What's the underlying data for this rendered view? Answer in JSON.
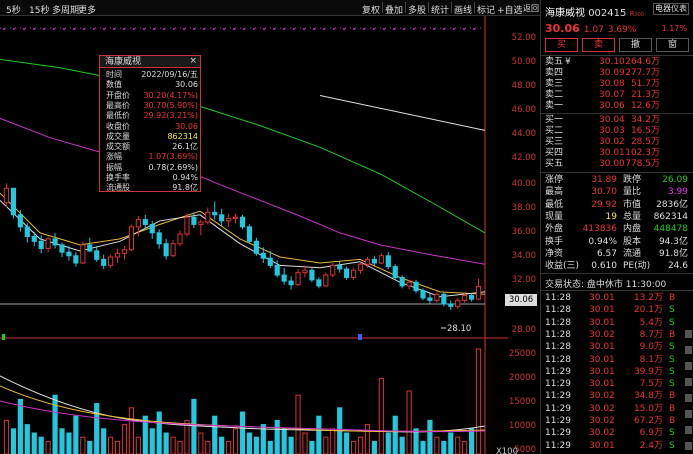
{
  "toolbar": {
    "left": [
      "5秒",
      "15秒",
      "多周期",
      "更多"
    ],
    "right": [
      "复权",
      "叠加",
      "多股",
      "统计",
      "画线",
      "标记",
      "+自选",
      "返回"
    ]
  },
  "y_axis": [
    "52.00",
    "50.00",
    "48.00",
    "46.00",
    "44.00",
    "42.00",
    "40.00",
    "38.00",
    "36.00",
    "34.00",
    "32.00",
    "30.06",
    "28.00"
  ],
  "vol_axis": [
    "25000",
    "20000",
    "15000",
    "10000",
    "5000",
    "X100"
  ],
  "current_price_label": "30.06",
  "low_marker": "28.10",
  "tooltip": {
    "title": "海康威视",
    "close": "×",
    "rows": [
      {
        "k": "时间",
        "v": "2022/09/16/五",
        "c": "#ddd"
      },
      {
        "k": "数值",
        "v": "30.06",
        "c": "#ddd"
      },
      {
        "k": "开盘价",
        "v": "30.20(4.17%)",
        "c": "#e33"
      },
      {
        "k": "最高价",
        "v": "30.70(5.90%)",
        "c": "#e33"
      },
      {
        "k": "最低价",
        "v": "29.92(3.21%)",
        "c": "#e33"
      },
      {
        "k": "收盘价",
        "v": "30.06",
        "c": "#e33"
      },
      {
        "k": "成交量",
        "v": "862314",
        "c": "#ee3"
      },
      {
        "k": "成交额",
        "v": "26.1亿",
        "c": "#ddd"
      },
      {
        "k": "涨幅",
        "v": "1.07(3.69%)",
        "c": "#e33"
      },
      {
        "k": "振幅",
        "v": "0.78(2.69%)",
        "c": "#ddd"
      },
      {
        "k": "换手率",
        "v": "0.94%",
        "c": "#ddd"
      },
      {
        "k": "流通股",
        "v": "91.8亿",
        "c": "#ddd"
      }
    ]
  },
  "stock": {
    "name": "海康威视",
    "code": "002415",
    "r": "R",
    "r_sub": "300",
    "price": "30.06",
    "change": "1.07",
    "pct": "3.69%",
    "meter_label": "电器仪表",
    "meter_pct": "1.17%"
  },
  "trade_buttons": [
    "买",
    "卖",
    "撤",
    "窗"
  ],
  "sell_book": [
    {
      "k": "卖五",
      "p": "30.10",
      "v": "264.6万"
    },
    {
      "k": "卖四",
      "p": "30.09",
      "v": "277.7万"
    },
    {
      "k": "卖三",
      "p": "30.08",
      "v": "51.7万"
    },
    {
      "k": "卖二",
      "p": "30.07",
      "v": "21.3万"
    },
    {
      "k": "卖一",
      "p": "30.06",
      "v": "12.6万"
    }
  ],
  "sell_book_marker": "¥",
  "buy_book": [
    {
      "k": "买一",
      "p": "30.04",
      "v": "34.2万"
    },
    {
      "k": "买二",
      "p": "30.03",
      "v": "16.5万"
    },
    {
      "k": "买三",
      "p": "30.02",
      "v": "28.5万"
    },
    {
      "k": "买四",
      "p": "30.01",
      "v": "102.3万"
    },
    {
      "k": "买五",
      "p": "30.00",
      "v": "778.5万"
    }
  ],
  "stats": [
    {
      "k1": "涨停",
      "v1": "31.89",
      "c1": "#e33",
      "k2": "跌停",
      "v2": "26.09",
      "c2": "#2c2"
    },
    {
      "k1": "最高",
      "v1": "30.70",
      "c1": "#e33",
      "k2": "量比",
      "v2": "3.99",
      "c2": "#e3e"
    },
    {
      "k1": "最低",
      "v1": "29.92",
      "c1": "#e33",
      "k2": "市值",
      "v2": "2836亿",
      "c2": "#ddd"
    },
    {
      "k1": "现量",
      "v1": "19",
      "c1": "#ee3",
      "k2": "总量",
      "v2": "862314",
      "c2": "#ddd"
    },
    {
      "k1": "外盘",
      "v1": "413836",
      "c1": "#e33",
      "k2": "内盘",
      "v2": "448478",
      "c2": "#2c2"
    },
    {
      "k1": "换手",
      "v1": "0.94%",
      "c1": "#ddd",
      "k2": "股本",
      "v2": "94.3亿",
      "c2": "#ddd"
    },
    {
      "k1": "净资",
      "v1": "6.57",
      "c1": "#ddd",
      "k2": "流通",
      "v2": "91.8亿",
      "c2": "#ddd"
    },
    {
      "k1": "收益(三)",
      "v1": "0.610",
      "c1": "#ddd",
      "k2": "PE(动)",
      "v2": "24.6",
      "c2": "#ddd"
    }
  ],
  "status": "交易状态: 盘中休市 11:30:00",
  "ticks": [
    {
      "t": "11:28",
      "p": "30.01",
      "v": "13.2万",
      "s": "B"
    },
    {
      "t": "11:28",
      "p": "30.01",
      "v": "20.1万",
      "s": "S"
    },
    {
      "t": "11:28",
      "p": "30.01",
      "v": "5.4万",
      "s": "S"
    },
    {
      "t": "11:28",
      "p": "30.02",
      "v": "8.7万",
      "s": "B"
    },
    {
      "t": "11:28",
      "p": "30.01",
      "v": "9.0万",
      "s": "S"
    },
    {
      "t": "11:28",
      "p": "30.01",
      "v": "8.1万",
      "s": "S"
    },
    {
      "t": "11:29",
      "p": "30.01",
      "v": "39.9万",
      "s": "S"
    },
    {
      "t": "11:29",
      "p": "30.01",
      "v": "7.5万",
      "s": "S"
    },
    {
      "t": "11:29",
      "p": "30.02",
      "v": "34.8万",
      "s": "B"
    },
    {
      "t": "11:29",
      "p": "30.02",
      "v": "15.0万",
      "s": "B"
    },
    {
      "t": "11:29",
      "p": "30.02",
      "v": "67.2万",
      "s": "B"
    },
    {
      "t": "11:29",
      "p": "30.02",
      "v": "6.9万",
      "s": "S"
    },
    {
      "t": "11:29",
      "p": "30.01",
      "v": "2.4万",
      "s": "S"
    }
  ],
  "chart_data": {
    "type": "candlestick",
    "ylim": [
      27,
      53
    ],
    "candles": [
      [
        37.0,
        38.6,
        36.6,
        38.2
      ],
      [
        38.2,
        38.0,
        35.7,
        36.0
      ],
      [
        36.0,
        36.4,
        34.6,
        35.0
      ],
      [
        35.0,
        35.3,
        33.7,
        34.2
      ],
      [
        34.2,
        34.6,
        33.4,
        33.8
      ],
      [
        33.8,
        34.3,
        32.8,
        33.2
      ],
      [
        33.2,
        34.2,
        32.9,
        34.0
      ],
      [
        34.0,
        34.5,
        33.2,
        33.5
      ],
      [
        33.5,
        33.7,
        32.5,
        32.9
      ],
      [
        32.9,
        33.4,
        32.2,
        32.6
      ],
      [
        32.6,
        32.9,
        31.7,
        32.0
      ],
      [
        32.0,
        33.8,
        31.9,
        33.5
      ],
      [
        33.5,
        34.1,
        32.9,
        33.0
      ],
      [
        33.0,
        33.4,
        32.1,
        32.3
      ],
      [
        32.3,
        32.7,
        31.5,
        31.8
      ],
      [
        31.8,
        32.7,
        31.6,
        32.5
      ],
      [
        32.5,
        33.2,
        32.0,
        32.8
      ],
      [
        32.8,
        33.4,
        32.3,
        33.1
      ],
      [
        33.1,
        35.2,
        33.0,
        35.0
      ],
      [
        35.0,
        35.9,
        34.2,
        35.6
      ],
      [
        35.6,
        36.0,
        34.8,
        35.2
      ],
      [
        35.2,
        35.5,
        34.0,
        34.5
      ],
      [
        34.5,
        34.8,
        33.2,
        33.6
      ],
      [
        33.6,
        34.0,
        32.3,
        32.6
      ],
      [
        32.6,
        33.9,
        32.5,
        33.6
      ],
      [
        33.6,
        34.7,
        33.4,
        34.4
      ],
      [
        34.4,
        36.1,
        34.2,
        35.8
      ],
      [
        35.8,
        36.1,
        34.9,
        35.2
      ],
      [
        35.2,
        35.6,
        34.3,
        35.4
      ],
      [
        35.4,
        36.6,
        35.2,
        36.2
      ],
      [
        36.2,
        37.1,
        35.6,
        36.0
      ],
      [
        36.0,
        36.5,
        35.1,
        35.5
      ],
      [
        35.5,
        36.1,
        35.0,
        35.7
      ],
      [
        35.7,
        36.1,
        35.3,
        35.8
      ],
      [
        35.8,
        36.0,
        34.8,
        35.0
      ],
      [
        35.0,
        35.2,
        33.6,
        33.8
      ],
      [
        33.8,
        34.1,
        32.6,
        32.8
      ],
      [
        32.8,
        33.3,
        32.0,
        32.4
      ],
      [
        32.4,
        33.0,
        31.6,
        31.8
      ],
      [
        31.8,
        32.2,
        30.8,
        31.0
      ],
      [
        31.0,
        31.6,
        30.2,
        30.5
      ],
      [
        30.5,
        30.9,
        29.8,
        30.2
      ],
      [
        30.2,
        31.5,
        30.1,
        31.2
      ],
      [
        31.2,
        31.8,
        30.8,
        31.4
      ],
      [
        31.4,
        31.6,
        30.4,
        30.6
      ],
      [
        30.6,
        30.8,
        29.9,
        30.1
      ],
      [
        30.1,
        31.2,
        30.0,
        31.0
      ],
      [
        31.0,
        32.0,
        30.8,
        31.8
      ],
      [
        31.8,
        32.2,
        31.2,
        31.5
      ],
      [
        31.5,
        31.7,
        30.6,
        30.8
      ],
      [
        30.8,
        31.6,
        30.6,
        31.4
      ],
      [
        31.4,
        32.1,
        31.1,
        31.9
      ],
      [
        31.9,
        32.5,
        31.6,
        32.3
      ],
      [
        32.3,
        32.6,
        31.8,
        32.0
      ],
      [
        32.0,
        32.8,
        31.9,
        32.6
      ],
      [
        32.6,
        32.9,
        31.5,
        31.7
      ],
      [
        31.7,
        31.9,
        30.6,
        30.8
      ],
      [
        30.8,
        31.0,
        29.9,
        30.1
      ],
      [
        30.1,
        30.6,
        29.8,
        30.4
      ],
      [
        30.4,
        30.6,
        29.5,
        29.7
      ],
      [
        29.7,
        29.9,
        28.9,
        29.1
      ],
      [
        29.1,
        29.5,
        28.6,
        28.9
      ],
      [
        28.9,
        29.6,
        28.7,
        29.4
      ],
      [
        29.4,
        29.6,
        28.4,
        28.6
      ],
      [
        28.6,
        28.9,
        28.1,
        28.4
      ],
      [
        28.4,
        29.1,
        28.2,
        28.9
      ],
      [
        28.9,
        29.5,
        28.7,
        29.3
      ],
      [
        29.3,
        29.5,
        28.8,
        29.0
      ],
      [
        29.0,
        30.7,
        28.9,
        30.06
      ]
    ],
    "ma": [
      {
        "color": "#e0e0e0",
        "points": [
          [
            320,
            45.9
          ],
          [
            485,
            43.0
          ]
        ]
      },
      {
        "color": "#22cc22",
        "points": [
          [
            0,
            48.9
          ],
          [
            60,
            48.2
          ],
          [
            140,
            46.9
          ],
          [
            200,
            45.0
          ],
          [
            260,
            43.4
          ],
          [
            320,
            41.6
          ],
          [
            380,
            39.4
          ],
          [
            430,
            37.1
          ],
          [
            485,
            34.5
          ]
        ]
      },
      {
        "color": "#cc33cc",
        "points": [
          [
            0,
            44.0
          ],
          [
            50,
            42.4
          ],
          [
            100,
            41.2
          ],
          [
            160,
            40.6
          ],
          [
            220,
            38.5
          ],
          [
            260,
            37.2
          ],
          [
            300,
            35.9
          ],
          [
            340,
            34.5
          ],
          [
            380,
            33.5
          ],
          [
            430,
            32.7
          ],
          [
            485,
            31.9
          ]
        ]
      },
      {
        "color": "#e8b830",
        "points": [
          [
            0,
            37.8
          ],
          [
            40,
            34.5
          ],
          [
            80,
            33.5
          ],
          [
            120,
            34.0
          ],
          [
            160,
            35.2
          ],
          [
            200,
            36.3
          ],
          [
            240,
            34.0
          ],
          [
            280,
            32.5
          ],
          [
            320,
            32.0
          ],
          [
            360,
            32.3
          ],
          [
            400,
            30.8
          ],
          [
            440,
            29.6
          ],
          [
            485,
            29.4
          ]
        ]
      },
      {
        "color": "#dddddd",
        "points": [
          [
            0,
            37.2
          ],
          [
            40,
            34.0
          ],
          [
            80,
            33.0
          ],
          [
            120,
            33.8
          ],
          [
            160,
            35.5
          ],
          [
            200,
            36.0
          ],
          [
            240,
            33.6
          ],
          [
            280,
            31.8
          ],
          [
            320,
            31.6
          ],
          [
            360,
            32.1
          ],
          [
            400,
            30.4
          ],
          [
            440,
            29.2
          ],
          [
            485,
            29.6
          ]
        ]
      }
    ],
    "volume": [
      8,
      6,
      13,
      7,
      5,
      4,
      3,
      14,
      6,
      5,
      9,
      4,
      3,
      12,
      6,
      4,
      3,
      7,
      11,
      4,
      9,
      6,
      10,
      5,
      4,
      3,
      8,
      13,
      5,
      3,
      9,
      4,
      3,
      6,
      10,
      5,
      4,
      7,
      3,
      8,
      6,
      4,
      14,
      5,
      3,
      9,
      4,
      6,
      11,
      5,
      3,
      4,
      7,
      3,
      18,
      5,
      9,
      4,
      15,
      6,
      3,
      8,
      4,
      3,
      5,
      4,
      3,
      6,
      25
    ]
  }
}
